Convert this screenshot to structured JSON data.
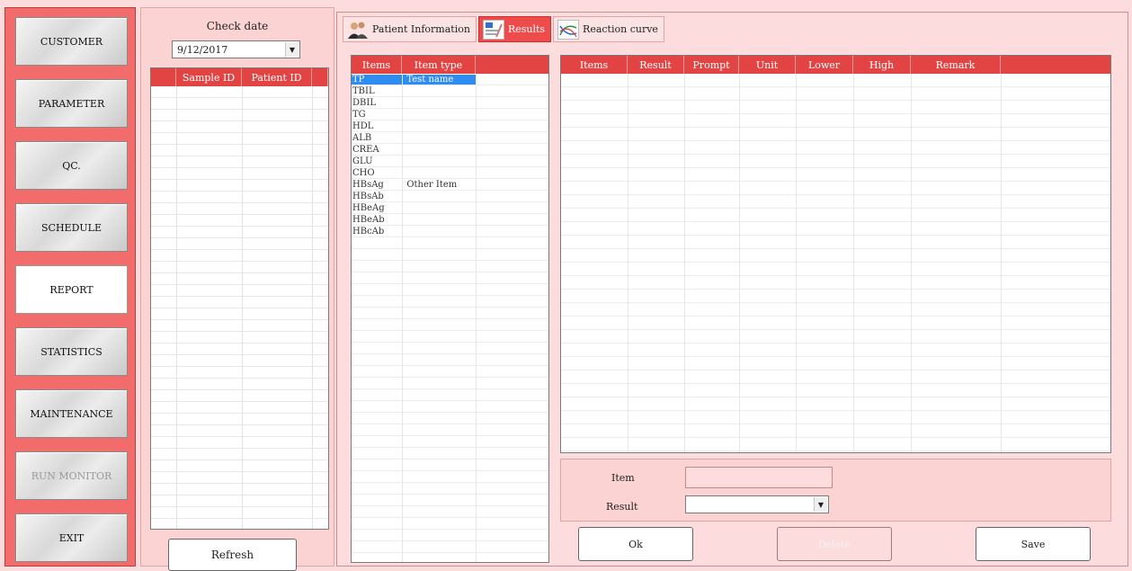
{
  "nav": {
    "items": [
      {
        "label": "CUSTOMER"
      },
      {
        "label": "PARAMETER"
      },
      {
        "label": "QC."
      },
      {
        "label": "SCHEDULE"
      },
      {
        "label": "REPORT"
      },
      {
        "label": "STATISTICS"
      },
      {
        "label": "MAINTENANCE"
      },
      {
        "label": "RUN MONITOR"
      },
      {
        "label": "EXIT"
      }
    ],
    "active": "REPORT",
    "disabled": "RUN MONITOR"
  },
  "sample": {
    "check_date_label": "Check date",
    "date_value": "9/12/2017",
    "columns": [
      "Sample ID",
      "Patient ID"
    ],
    "refresh_label": "Refresh"
  },
  "tabs": [
    {
      "label": "Patient Information",
      "icon": "patient-icon"
    },
    {
      "label": "Results",
      "icon": "results-icon"
    },
    {
      "label": "Reaction curve",
      "icon": "curve-icon"
    }
  ],
  "active_tab": "Results",
  "items_table": {
    "columns": [
      "Items",
      "Item type"
    ],
    "rows": [
      {
        "item": "TP",
        "type": "Test name",
        "selected": true
      },
      {
        "item": "TBIL",
        "type": ""
      },
      {
        "item": "DBIL",
        "type": ""
      },
      {
        "item": "TG",
        "type": ""
      },
      {
        "item": "HDL",
        "type": ""
      },
      {
        "item": "ALB",
        "type": ""
      },
      {
        "item": "CREA",
        "type": ""
      },
      {
        "item": "GLU",
        "type": ""
      },
      {
        "item": "CHO",
        "type": ""
      },
      {
        "item": "HBsAg",
        "type": "Other Item"
      },
      {
        "item": "HBsAb",
        "type": ""
      },
      {
        "item": "HBeAg",
        "type": ""
      },
      {
        "item": "HBeAb",
        "type": ""
      },
      {
        "item": "HBcAb",
        "type": ""
      }
    ]
  },
  "results_table": {
    "columns": [
      "Items",
      "Result",
      "Prompt",
      "Unit",
      "Lower",
      "High",
      "Remark"
    ]
  },
  "edit": {
    "item_label": "Item",
    "item_value": "",
    "result_label": "Result",
    "result_value": ""
  },
  "actions": {
    "ok_label": "Ok",
    "delete_label": "Delete",
    "save_label": "Save"
  },
  "colors": {
    "header_red": "#e24444",
    "nav_red": "#f26c6c",
    "panel_pink": "#fcdcdc",
    "selection_blue": "#2f8cf0"
  }
}
